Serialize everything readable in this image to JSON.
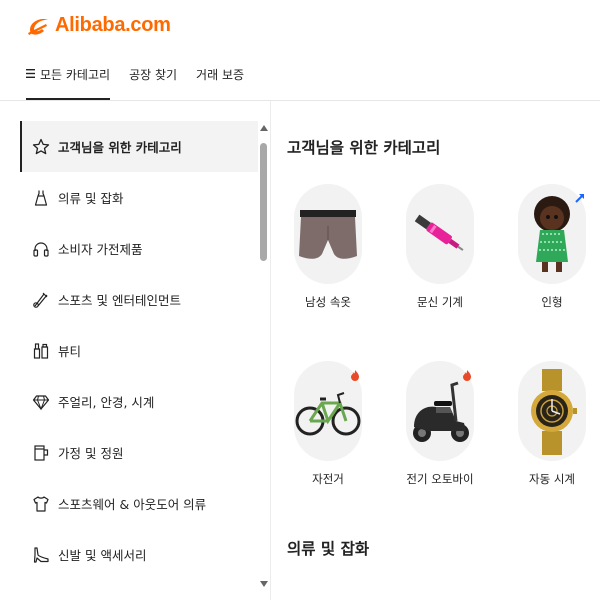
{
  "brand": {
    "name": "Alibaba.com",
    "color": "#ff6a00"
  },
  "topnav": {
    "tabs": [
      {
        "label": "모든 카테고리",
        "active": true
      },
      {
        "label": "공장 찾기"
      },
      {
        "label": "거래 보증"
      }
    ]
  },
  "sidebar": {
    "items": [
      {
        "label": "고객님을 위한 카테고리",
        "icon": "star-icon",
        "active": true
      },
      {
        "label": "의류 및 잡화",
        "icon": "dress-icon"
      },
      {
        "label": "소비자 가전제품",
        "icon": "headphones-icon"
      },
      {
        "label": "스포츠 및 엔터테인먼트",
        "icon": "sports-icon"
      },
      {
        "label": "뷰티",
        "icon": "cosmetics-icon"
      },
      {
        "label": "주얼리, 안경, 시계",
        "icon": "diamond-icon"
      },
      {
        "label": "가정 및 정원",
        "icon": "home-garden-icon"
      },
      {
        "label": "스포츠웨어 & 아웃도어 의류",
        "icon": "shirt-icon"
      },
      {
        "label": "신발 및 액세서리",
        "icon": "shoe-icon"
      }
    ]
  },
  "main": {
    "section1": {
      "title": "고객님을 위한 카테고리",
      "tiles": [
        {
          "label": "남성 속옷",
          "icon": "underwear-icon"
        },
        {
          "label": "문신 기계",
          "icon": "tattoo-machine-icon"
        },
        {
          "label": "인형",
          "icon": "doll-icon",
          "badge": "trending-up-icon"
        },
        {
          "label": "자전거",
          "icon": "bicycle-icon",
          "badge": "hot-icon"
        },
        {
          "label": "전기 오토바이",
          "icon": "scooter-icon",
          "badge": "hot-icon"
        },
        {
          "label": "자동 시계",
          "icon": "watch-icon"
        }
      ]
    },
    "section2": {
      "title": "의류 및 잡화"
    }
  }
}
